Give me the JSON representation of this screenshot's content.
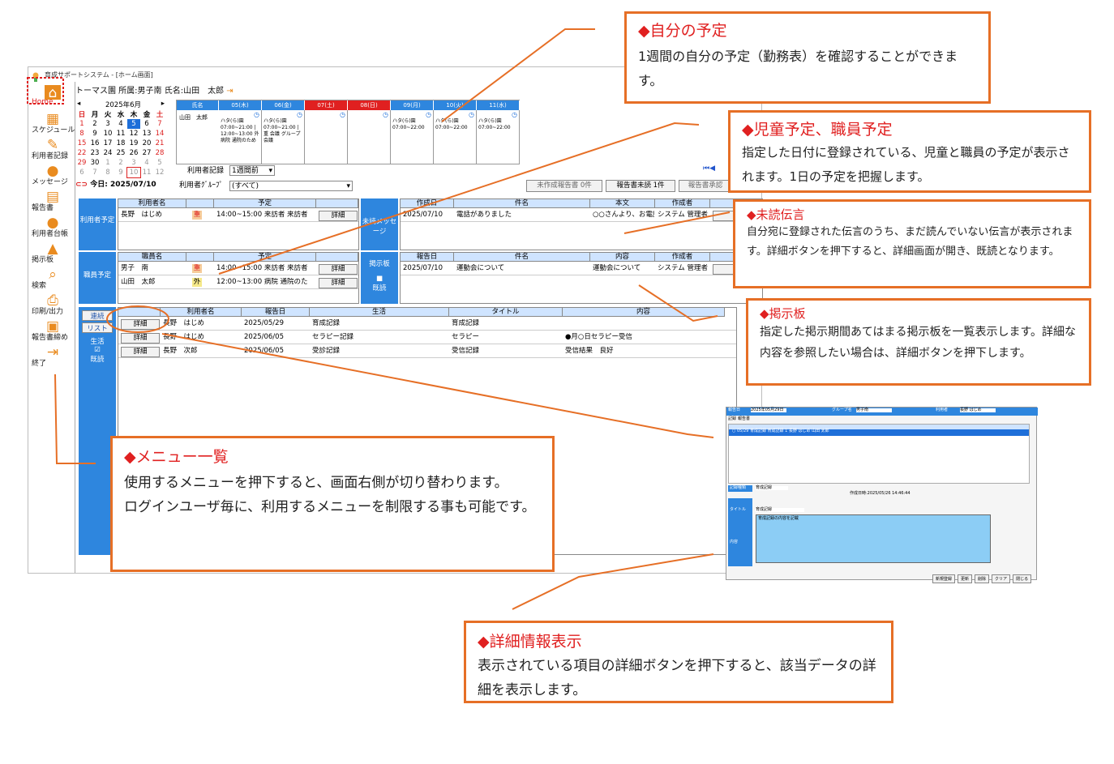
{
  "app": {
    "title": "育成サポートシステム - [ホーム画面]",
    "user_bar": "トーマス園 所属:男子南 氏名:山田　太郎",
    "menu": [
      {
        "icon": "home-icon",
        "label": "Home"
      },
      {
        "icon": "calendar-icon",
        "label": "スケジュール"
      },
      {
        "icon": "pen-icon",
        "label": "利用者記録"
      },
      {
        "icon": "message-icon",
        "label": "メッセージ"
      },
      {
        "icon": "report-icon",
        "label": "報告書"
      },
      {
        "icon": "person-icon",
        "label": "利用者台帳"
      },
      {
        "icon": "board-icon",
        "label": "掲示板"
      },
      {
        "icon": "search-icon",
        "label": "検索"
      },
      {
        "icon": "printer-icon",
        "label": "印刷/出力"
      },
      {
        "icon": "clipboard-icon",
        "label": "報告書締め"
      },
      {
        "icon": "exit-icon",
        "label": "終了"
      }
    ],
    "calendar": {
      "month": "2025年6月",
      "weekdays": [
        "日",
        "月",
        "火",
        "水",
        "木",
        "金",
        "土"
      ],
      "weeks": [
        [
          "1",
          "2",
          "3",
          "4",
          "5",
          "6",
          "7"
        ],
        [
          "8",
          "9",
          "10",
          "11",
          "12",
          "13",
          "14"
        ],
        [
          "15",
          "16",
          "17",
          "18",
          "19",
          "20",
          "21"
        ],
        [
          "22",
          "23",
          "24",
          "25",
          "26",
          "27",
          "28"
        ],
        [
          "29",
          "30",
          "1",
          "2",
          "3",
          "4",
          "5"
        ],
        [
          "6",
          "7",
          "8",
          "9",
          "10",
          "11",
          "12"
        ]
      ],
      "today": "今日: 2025/07/10"
    },
    "schedule": {
      "headers": [
        "氏名",
        "05(木)",
        "06(金)",
        "07(土)",
        "08(日)",
        "09(月)",
        "10(火)",
        "11(水)"
      ],
      "name": "山田　太郎",
      "cells": [
        "ハタ(ら)園 07:00~21:00 | 12:00~13:00 外 病院 通院のため",
        "ハタ(ら)園 07:00~21:00 | 重 会議 グループ会議",
        "",
        "",
        "ハタ(ら)園 07:00~22:00",
        "ハタ(ら)園 07:00~22:00",
        "ハタ(ら)園 07:00~22:00"
      ]
    },
    "record_label": "利用者記録",
    "record_value": "1週間前",
    "group_label": "利用者ｸﾞﾙｰﾌﾟ",
    "group_value": "(すべて)",
    "btn_unwritten": "未作成報告書 0件",
    "btn_unread": "報告書未読 1件",
    "btn_approve": "報告書承認",
    "user_sched": {
      "side": "利用者予定",
      "headers": [
        "利用者名",
        "",
        "予定",
        ""
      ],
      "rows": [
        [
          "長野　はじめ",
          "重",
          "14:00~15:00  来訪者  来訪者",
          "詳細"
        ]
      ]
    },
    "staff_sched": {
      "side": "職員予定",
      "headers": [
        "職員名",
        "",
        "予定",
        ""
      ],
      "rows": [
        [
          "男子　南",
          "重",
          "14:00~15:00  来訪者  来訪者",
          "詳細"
        ],
        [
          "山田　太郎",
          "外",
          "12:00~13:00  病院  通院のた",
          "詳細"
        ]
      ]
    },
    "msg": {
      "side": "未読メッセージ",
      "headers": [
        "作成日",
        "件名",
        "本文",
        "作成者",
        ""
      ],
      "rows": [
        [
          "2025/07/10",
          "電話がありました",
          "○○さんより、お電話",
          "システム 管理者",
          "詳"
        ]
      ]
    },
    "board": {
      "side": "掲示板",
      "side2": "既読",
      "headers": [
        "報告日",
        "件名",
        "内容",
        "作成者",
        ""
      ],
      "rows": [
        [
          "2025/07/10",
          "運動会について",
          "運動会について",
          "システム 管理者",
          "詳"
        ]
      ]
    },
    "records": {
      "tabs": [
        "連続",
        "リスト"
      ],
      "side": "生活",
      "side2": "既読",
      "headers": [
        "",
        "利用者名",
        "報告日",
        "生活",
        "タイトル",
        "内容"
      ],
      "rows": [
        [
          "詳細",
          "長野　はじめ",
          "2025/05/29",
          "育成記録",
          "育成記録",
          ""
        ],
        [
          "詳細",
          "長野　はじめ",
          "2025/06/05",
          "セラピー記録",
          "セラピー",
          "●月○日セラピー受信"
        ],
        [
          "詳細",
          "長野　次郎",
          "2025/06/05",
          "受診記録",
          "受信記録",
          "受信結果　良好"
        ]
      ]
    }
  },
  "callouts": {
    "my_sched": {
      "h": "◆自分の予定",
      "b": "1週間の自分の予定（勤務表）を確認することができます。"
    },
    "child_staff": {
      "h": "◆児童予定、職員予定",
      "b": "指定した日付に登録されている、児童と職員の予定が表示されます。1日の予定を把握します。"
    },
    "unread": {
      "h": "◆未読伝言",
      "b": "自分宛に登録された伝言のうち、まだ読んでいない伝言が表示されます。詳細ボタンを押下すると、詳細画面が開き、既読となります。"
    },
    "board": {
      "h": "◆掲示板",
      "b": "指定した掲示期間あてはまる掲示板を一覧表示します。詳細な内容を参照したい場合は、詳細ボタンを押下します。"
    },
    "menu": {
      "h": "◆メニュー一覧",
      "b": "使用するメニューを押下すると、画面右側が切り替わります。\nログインユーザ毎に、利用するメニューを制限する事も可能です。"
    },
    "detail": {
      "h": "◆詳細情報表示",
      "b": "表示されている項目の詳細ボタンを押下すると、該当データの詳細を表示します。"
    }
  },
  "detail_win": {
    "date_label": "報告日",
    "date": "2025年05月29日",
    "group_label": "グループ名",
    "group": "男子南",
    "user_label": "利用者",
    "user": "長野 はじめ",
    "tabs": [
      "記録",
      "報告書"
    ],
    "row": "○ 05/29 育成記録 育成記録 1 長野 はじめ 山田 太郎",
    "kind_label": "記録種類",
    "kind": "育成記録",
    "created": "作成日時:2025/05/26 14:46:44",
    "title_label": "タイトル",
    "title": "育成記録",
    "content_label": "内容",
    "content": "育成記録の内容を記載",
    "buttons": [
      "新規登録",
      "更新",
      "削除",
      "クリア",
      "閉じる"
    ]
  },
  "colors": {
    "accent": "#e66f26",
    "blue": "#2e86de",
    "red": "#e02020"
  }
}
